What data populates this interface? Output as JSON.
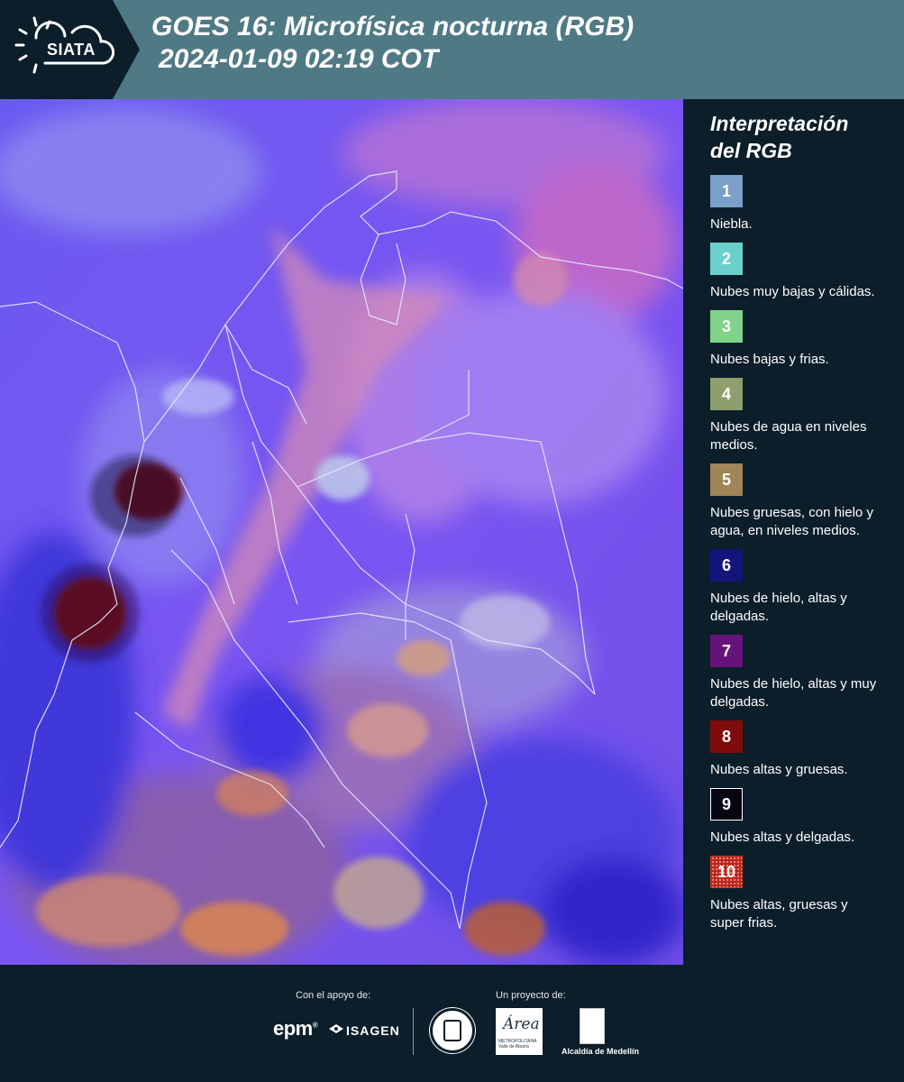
{
  "header": {
    "logo_text": "SIATA",
    "title_line1": "GOES 16: Microfísica nocturna (RGB)",
    "title_line2": "2024-01-09 02:19 COT",
    "bg_color": "#4f7a85"
  },
  "legend": {
    "title_line1": "Interpretación",
    "title_line2": "del RGB",
    "items": [
      {
        "num": "1",
        "label": "Niebla.",
        "color": "#7a9fc9"
      },
      {
        "num": "2",
        "label": "Nubes muy bajas y cálidas.",
        "color": "#6bd0cc"
      },
      {
        "num": "3",
        "label": "Nubes bajas y frias.",
        "color": "#80d38a"
      },
      {
        "num": "4",
        "label": "Nubes de agua en niveles medios.",
        "color": "#8e9e6c"
      },
      {
        "num": "5",
        "label": "Nubes gruesas, con hielo y agua, en niveles medios.",
        "color": "#a08556"
      },
      {
        "num": "6",
        "label": "Nubes de hielo, altas y delgadas.",
        "color": "#15147a"
      },
      {
        "num": "7",
        "label": "Nubes de hielo, altas y muy delgadas.",
        "color": "#661379"
      },
      {
        "num": "8",
        "label": "Nubes altas y gruesas.",
        "color": "#800b0b"
      },
      {
        "num": "9",
        "label": "Nubes altas y delgadas.",
        "color": "#060612"
      },
      {
        "num": "10",
        "label": "Nubes altas, gruesas y super frias.",
        "color": "#b8261b"
      }
    ]
  },
  "footer": {
    "support_label": "Con el apoyo de:",
    "project_label": "Un proyecto de:",
    "epm_text": "epm",
    "epm_mark": "®",
    "isagen_text": "ISAGEN",
    "area_word": "Área",
    "area_small": "METROPOLITANA Valle de Aburrá",
    "alcaldia_label": "Alcaldía de Medellín"
  }
}
